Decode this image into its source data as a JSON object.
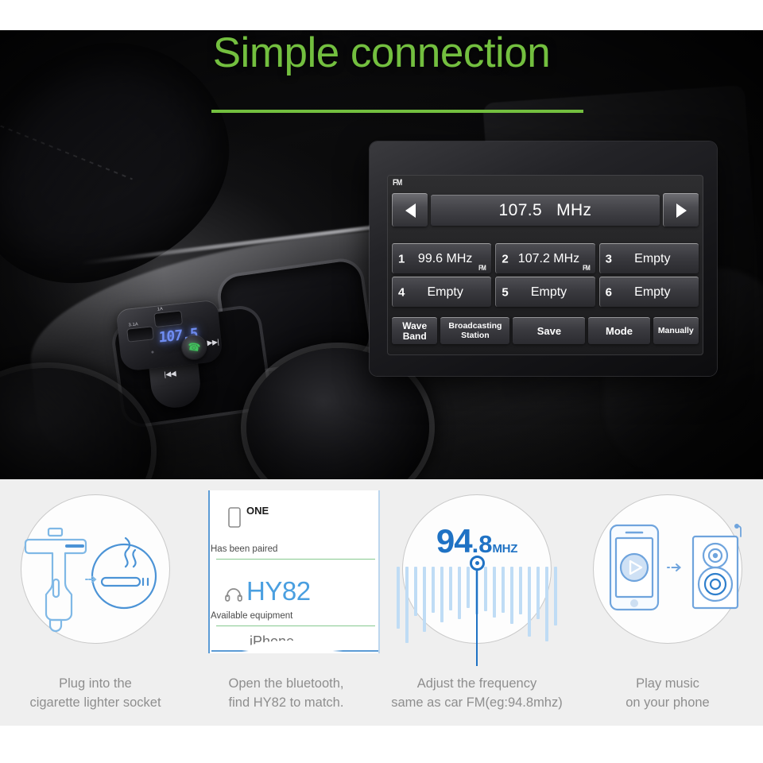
{
  "hero": {
    "title": "Simple connection",
    "title_color": "#73bf3f"
  },
  "car_radio": {
    "band_badge": "FM",
    "frequency": "107.5",
    "frequency_unit": "MHz",
    "prev_icon": "triangle-left-icon",
    "next_icon": "triangle-right-icon",
    "presets": [
      {
        "num": "1",
        "label": "99.6 MHz",
        "band": "FM"
      },
      {
        "num": "2",
        "label": "107.2 MHz",
        "band": "FM"
      },
      {
        "num": "3",
        "label": "Empty",
        "band": ""
      },
      {
        "num": "4",
        "label": "Empty",
        "band": ""
      },
      {
        "num": "5",
        "label": "Empty",
        "band": ""
      },
      {
        "num": "6",
        "label": "Empty",
        "band": ""
      }
    ],
    "functions": [
      {
        "line1": "Wave",
        "line2": "Band"
      },
      {
        "line1": "Broadcasting",
        "line2": "Station"
      },
      {
        "line1": "Save",
        "line2": ""
      },
      {
        "line1": "Mode",
        "line2": ""
      },
      {
        "line1": "Manually",
        "line2": ""
      }
    ]
  },
  "device": {
    "display": "107.5",
    "usb_port_1": "3.1A",
    "usb_port_2": "1A",
    "call_icon": "phone-icon",
    "next_icon": "next-track-icon",
    "prev_icon": "prev-track-icon"
  },
  "steps": [
    {
      "art": "charger-socket-icon",
      "caption_line1": "Plug into the",
      "caption_line2": "cigarette lighter socket"
    },
    {
      "art": "bluetooth-list-screenshot",
      "caption_line1": "Open the bluetooth,",
      "caption_line2": "find HY82 to match.",
      "screenshot": {
        "device_name": "ONE",
        "paired_header": "Has been paired",
        "paired_device": "HY82",
        "available_header": "Available equipment",
        "available_device": "iPhone"
      }
    },
    {
      "art": "frequency-dial-icon",
      "caption_line1": "Adjust the frequency",
      "caption_line2": "same as car FM(eg:94.8mhz)",
      "dial": {
        "whole": "94",
        "decimal": ".8",
        "unit": "MHZ"
      }
    },
    {
      "art": "phone-speaker-icon",
      "caption_line1": "Play music",
      "caption_line2": "on your phone"
    }
  ]
}
